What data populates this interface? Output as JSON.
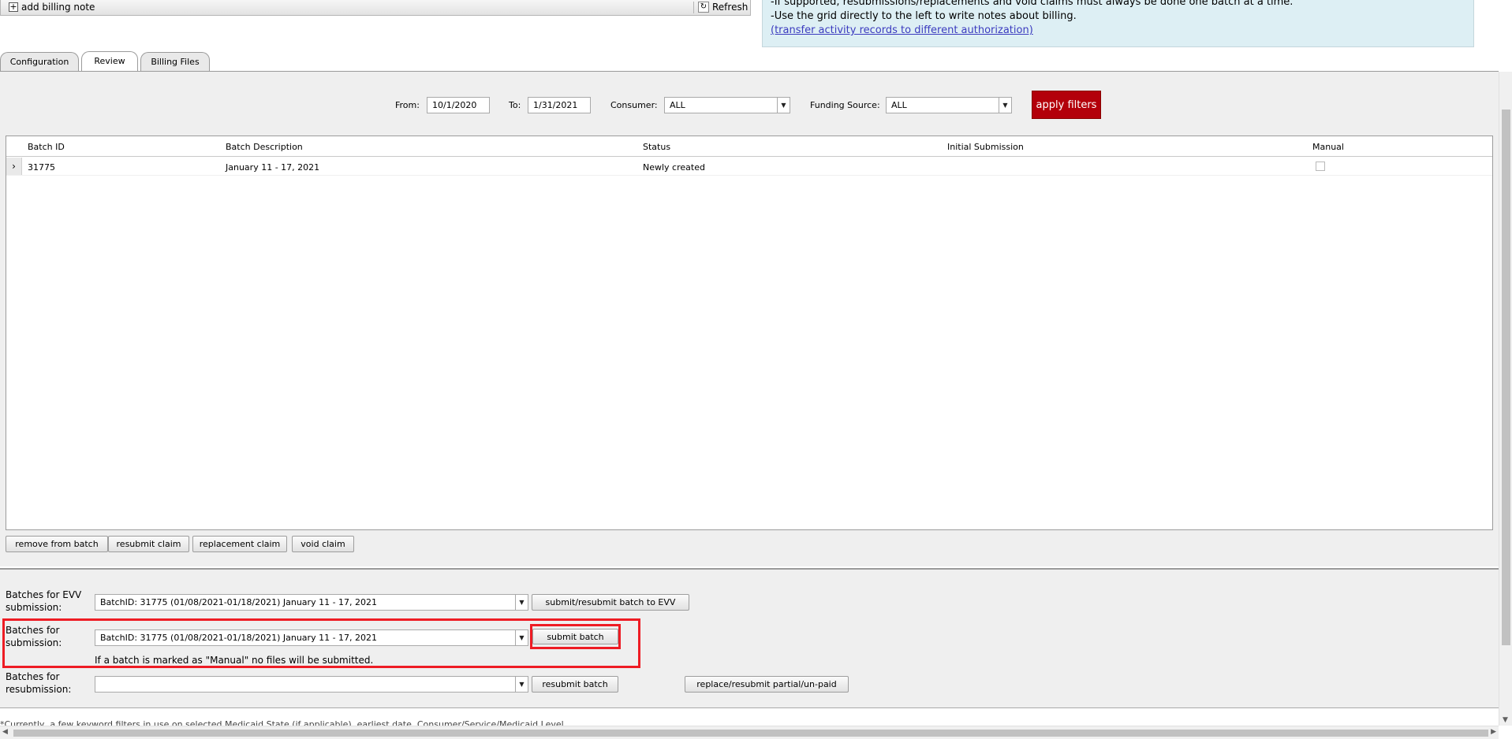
{
  "toolbar": {
    "add_note_label": "add billing note",
    "refresh_label": "Refresh"
  },
  "info": {
    "line1": "-If supported, resubmissions/replacements and void claims must always be done one batch at a time.",
    "line2": "-Use the grid directly to the left to write notes about billing.",
    "link": "(transfer activity records to different authorization)"
  },
  "tabs": [
    {
      "label": "Configuration",
      "active": false
    },
    {
      "label": "Review",
      "active": true
    },
    {
      "label": "Billing Files",
      "active": false
    }
  ],
  "filters": {
    "from_label": "From:",
    "from_value": "10/1/2020",
    "to_label": "To:",
    "to_value": "1/31/2021",
    "consumer_label": "Consumer:",
    "consumer_value": "ALL",
    "funding_label": "Funding Source:",
    "funding_value": "ALL",
    "apply_label": "apply filters"
  },
  "grid": {
    "columns": [
      "Batch ID",
      "Batch Description",
      "Status",
      "Initial Submission",
      "Manual"
    ],
    "rows": [
      {
        "batch_id": "31775",
        "description": "January 11 - 17, 2021",
        "status": "Newly created",
        "initial_submission": "",
        "manual": false
      }
    ]
  },
  "grid_actions": {
    "remove": "remove from batch",
    "resubmit": "resubmit claim",
    "replacement": "replacement claim",
    "void": "void claim"
  },
  "submission": {
    "evv_label": "Batches for EVV submission:",
    "evv_value": "BatchID: 31775 (01/08/2021-01/18/2021) January 11 - 17, 2021",
    "evv_button": "submit/resubmit batch to EVV",
    "batch_label": "Batches for submission:",
    "batch_value": "BatchID: 31775 (01/08/2021-01/18/2021) January 11 - 17, 2021",
    "batch_button": "submit batch",
    "manual_note": "If a batch is marked as \"Manual\" no files will be submitted.",
    "resub_label": "Batches for resubmission:",
    "resub_value": "",
    "resub_button": "resubmit batch",
    "replace_button": "replace/resubmit partial/un-paid"
  },
  "footer": {
    "text": "*Currently, a few keyword filters in use on selected Medicaid State (if applicable), earliest date, Consumer/Service/Medicaid Level"
  },
  "colors": {
    "accent_red": "#b3000a",
    "highlight_red": "#ee1c24",
    "info_bg": "#ddeff4",
    "link": "#3b3bbf"
  },
  "icons": [
    "plus-icon",
    "refresh-icon",
    "chevron-right-icon",
    "dropdown-arrow-icon"
  ]
}
